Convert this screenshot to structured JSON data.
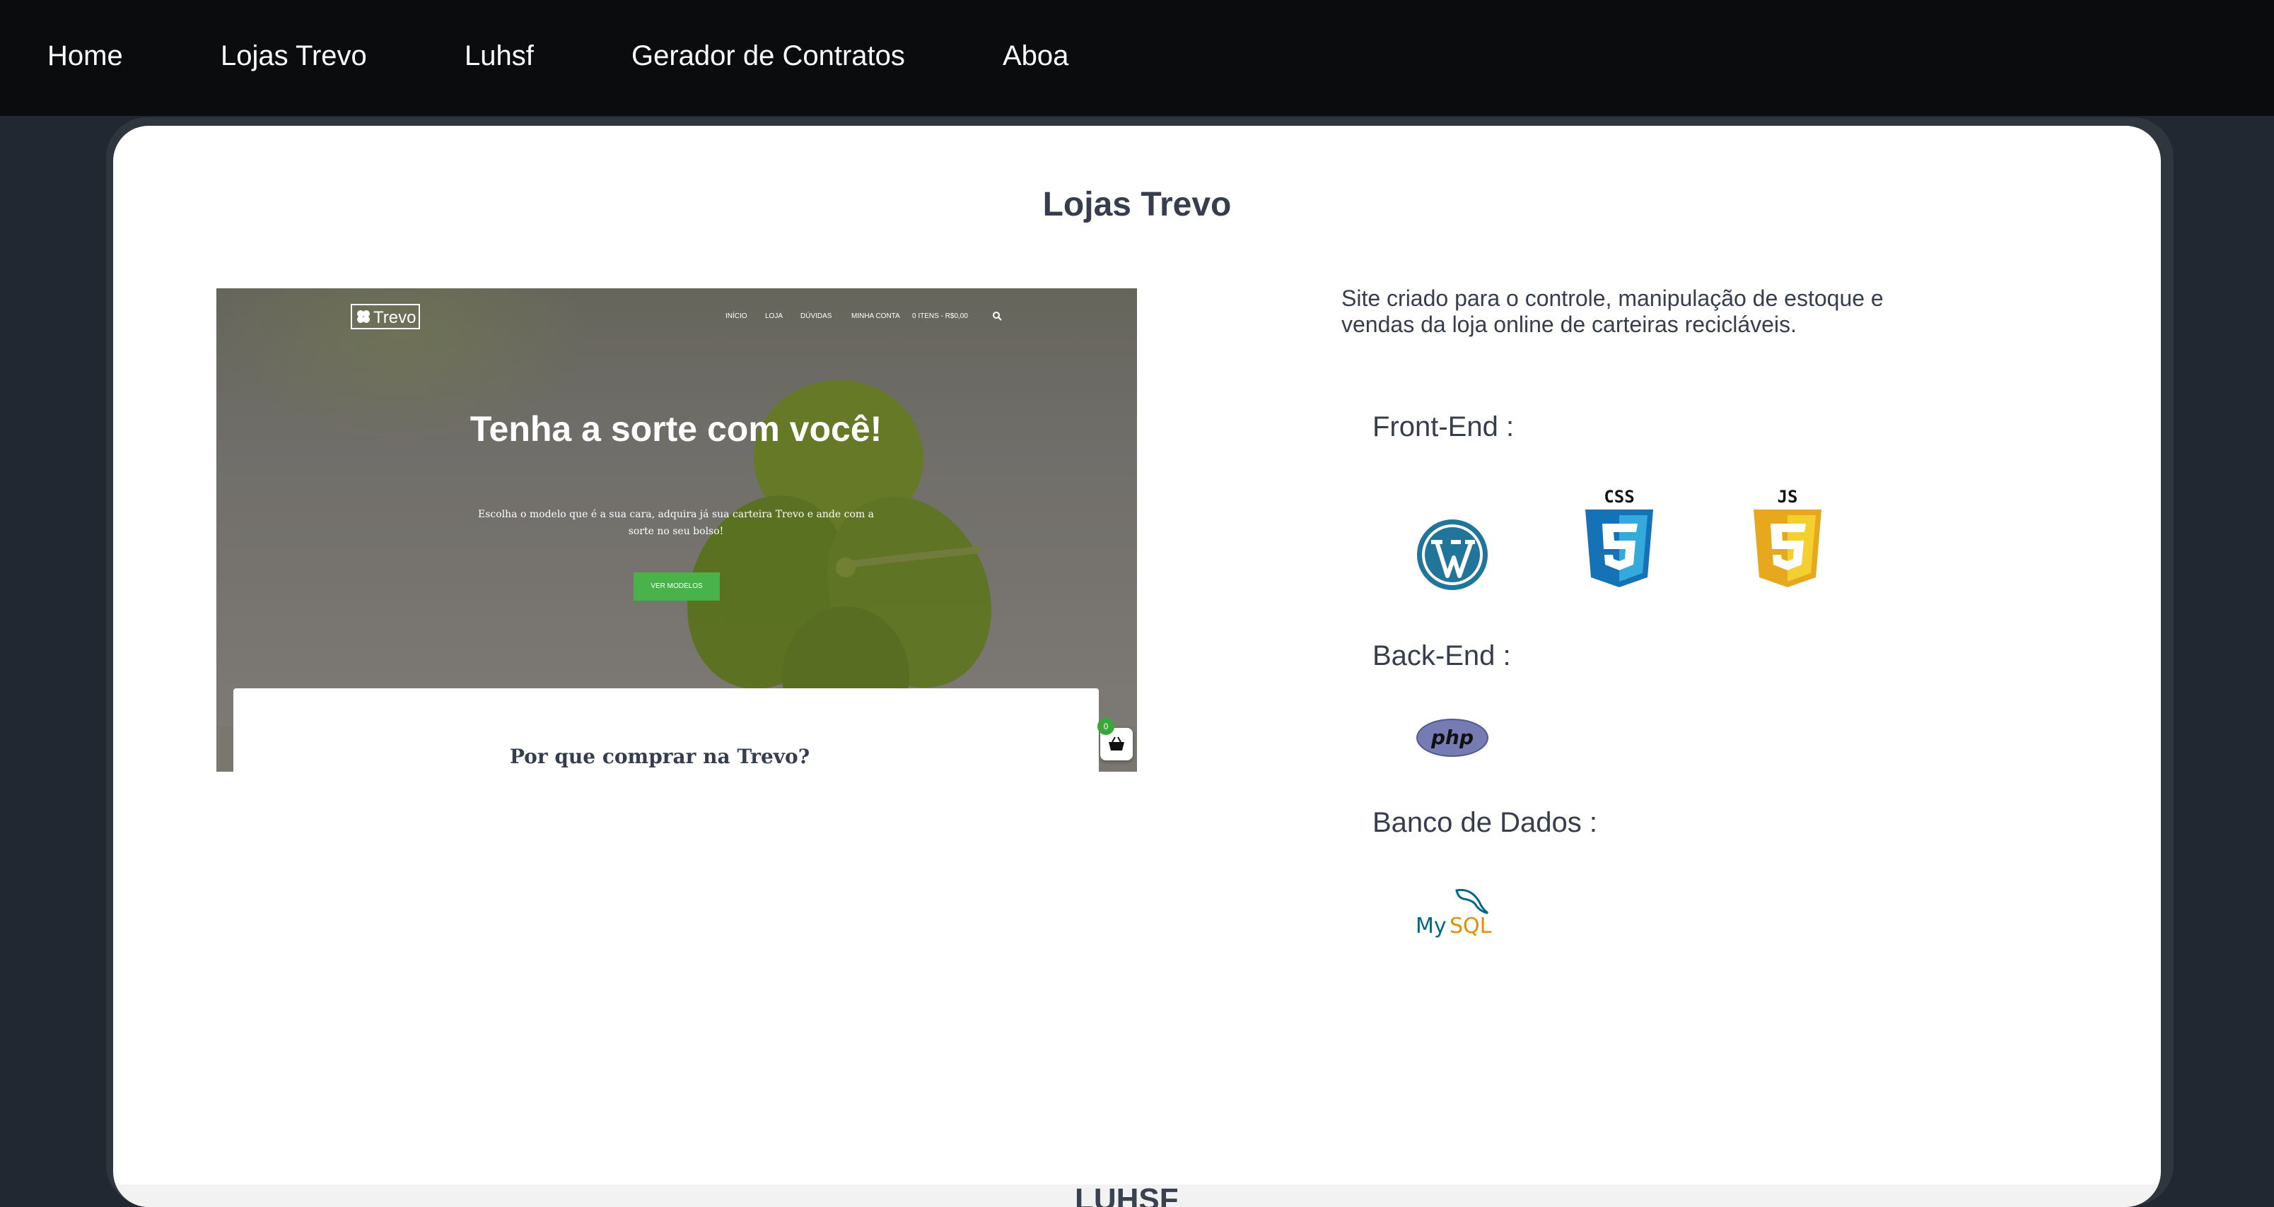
{
  "nav": {
    "items": [
      "Home",
      "Lojas Trevo",
      "Luhsf",
      "Gerador de Contratos",
      "Aboa"
    ]
  },
  "project": {
    "title": "Lojas Trevo",
    "description": "Site criado para o controle, manipulação de estoque e vendas da loja online de carteiras recicláveis.",
    "screenshot": {
      "logo": "Trevo",
      "nav": [
        "INÍCIO",
        "LOJA",
        "DÚVIDAS",
        "MINHA CONTA",
        "0 ITENS - R$0,00"
      ],
      "headline": "Tenha a sorte com você!",
      "subtitle": "Escolha o modelo que é a sua cara, adquira já sua carteira Trevo e ande com a sorte no seu bolso!",
      "button": "VER MODELOS",
      "section_title": "Por que comprar na Trevo?",
      "cart_count": "0"
    },
    "sections": {
      "frontend": "Front-End :",
      "backend": "Back-End :",
      "database": "Banco de Dados :"
    },
    "icons": {
      "frontend": [
        "wordpress-icon",
        "css3-icon",
        "javascript-icon"
      ],
      "backend": [
        "php-icon"
      ],
      "database": [
        "mysql-icon"
      ]
    }
  },
  "next_project": {
    "title": "LUHSF"
  },
  "colors": {
    "navbar": "#0b0c0e",
    "page_bg": "#222831",
    "text": "#363e4e",
    "accent_green": "#4ab24a"
  }
}
